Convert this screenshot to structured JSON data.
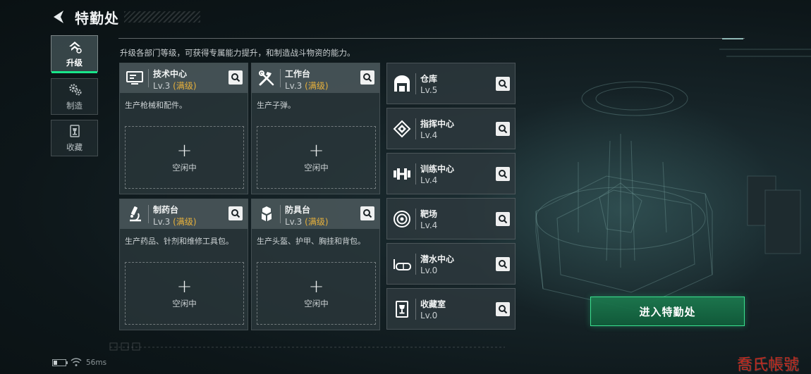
{
  "header": {
    "title": "特勤处",
    "description": "升级各部门等级，可获得专属能力提升，和制造战斗物资的能力。"
  },
  "tabs": [
    {
      "label": "升级",
      "icon": "upgrade-icon",
      "active": true
    },
    {
      "label": "制造",
      "icon": "gears-icon",
      "active": false
    },
    {
      "label": "收藏",
      "icon": "trophy-icon",
      "active": false
    }
  ],
  "stations": [
    {
      "name": "技术中心",
      "level": "Lv.3",
      "max": "(满级)",
      "desc": "生产枪械和配件。",
      "slot": "空闲中",
      "icon": "computer-icon"
    },
    {
      "name": "工作台",
      "level": "Lv.3",
      "max": "(满级)",
      "desc": "生产子弹。",
      "slot": "空闲中",
      "icon": "tools-icon"
    },
    {
      "name": "制药台",
      "level": "Lv.3",
      "max": "(满级)",
      "desc": "生产药品、针剂和维修工具包。",
      "slot": "空闲中",
      "icon": "microscope-icon"
    },
    {
      "name": "防具台",
      "level": "Lv.3",
      "max": "(满级)",
      "desc": "生产头盔、护甲、胸挂和背包。",
      "slot": "空闲中",
      "icon": "armor-icon"
    }
  ],
  "facilities": [
    {
      "name": "仓库",
      "level": "Lv.5",
      "icon": "warehouse-icon"
    },
    {
      "name": "指挥中心",
      "level": "Lv.4",
      "icon": "chip-icon"
    },
    {
      "name": "训练中心",
      "level": "Lv.4",
      "icon": "dumbbell-icon"
    },
    {
      "name": "靶场",
      "level": "Lv.4",
      "icon": "target-icon"
    },
    {
      "name": "潜水中心",
      "level": "Lv.0",
      "icon": "diving-mask-icon"
    },
    {
      "name": "收藏室",
      "level": "Lv.0",
      "icon": "trophy-icon"
    }
  ],
  "enter_button": "进入特勤处",
  "status": {
    "ping": "56ms"
  },
  "watermark": "喬氏帳號",
  "colors": {
    "accent_green": "#19e58a",
    "max_level": "#e8b13b",
    "button_green": "#1c784e"
  }
}
